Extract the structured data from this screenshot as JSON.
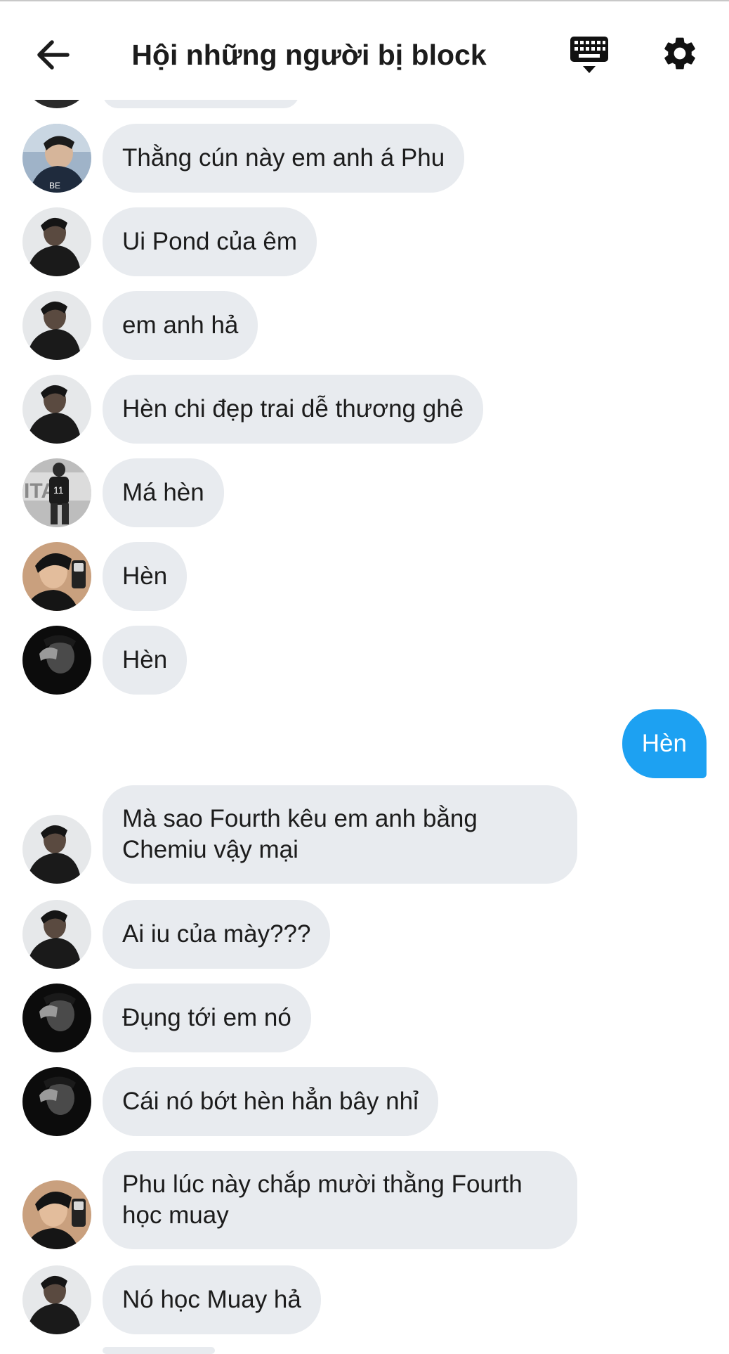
{
  "header": {
    "title": "Hội những người bị block",
    "back_icon": "back-arrow-icon",
    "keyboard_icon": "keyboard-icon",
    "settings_icon": "gear-icon"
  },
  "colors": {
    "incoming_bubble": "#e8ebef",
    "outgoing_bubble": "#1da1f2",
    "text": "#1c1c1c"
  },
  "messages": [
    {
      "sender": "other",
      "text": "Thằng cún này em anh á Phu"
    },
    {
      "sender": "other",
      "text": "Ui Pond của êm"
    },
    {
      "sender": "other",
      "text": "em anh hả"
    },
    {
      "sender": "other",
      "text": "Hèn chi đẹp trai dễ thương ghê"
    },
    {
      "sender": "other",
      "text": "Má hèn"
    },
    {
      "sender": "other",
      "text": "Hèn"
    },
    {
      "sender": "other",
      "text": "Hèn"
    },
    {
      "sender": "me",
      "text": "Hèn"
    },
    {
      "sender": "other",
      "text": "Mà sao Fourth kêu em anh bằng Chemiu vậy mại"
    },
    {
      "sender": "other",
      "text": "Ai iu của mày???"
    },
    {
      "sender": "other",
      "text": "Đụng tới em nó"
    },
    {
      "sender": "other",
      "text": "Cái nó bớt hèn hẳn bây nhỉ"
    },
    {
      "sender": "other",
      "text": "Phu lúc này chắp mười thằng Fourth học muay"
    },
    {
      "sender": "other",
      "text": "Nó học Muay hả"
    }
  ]
}
